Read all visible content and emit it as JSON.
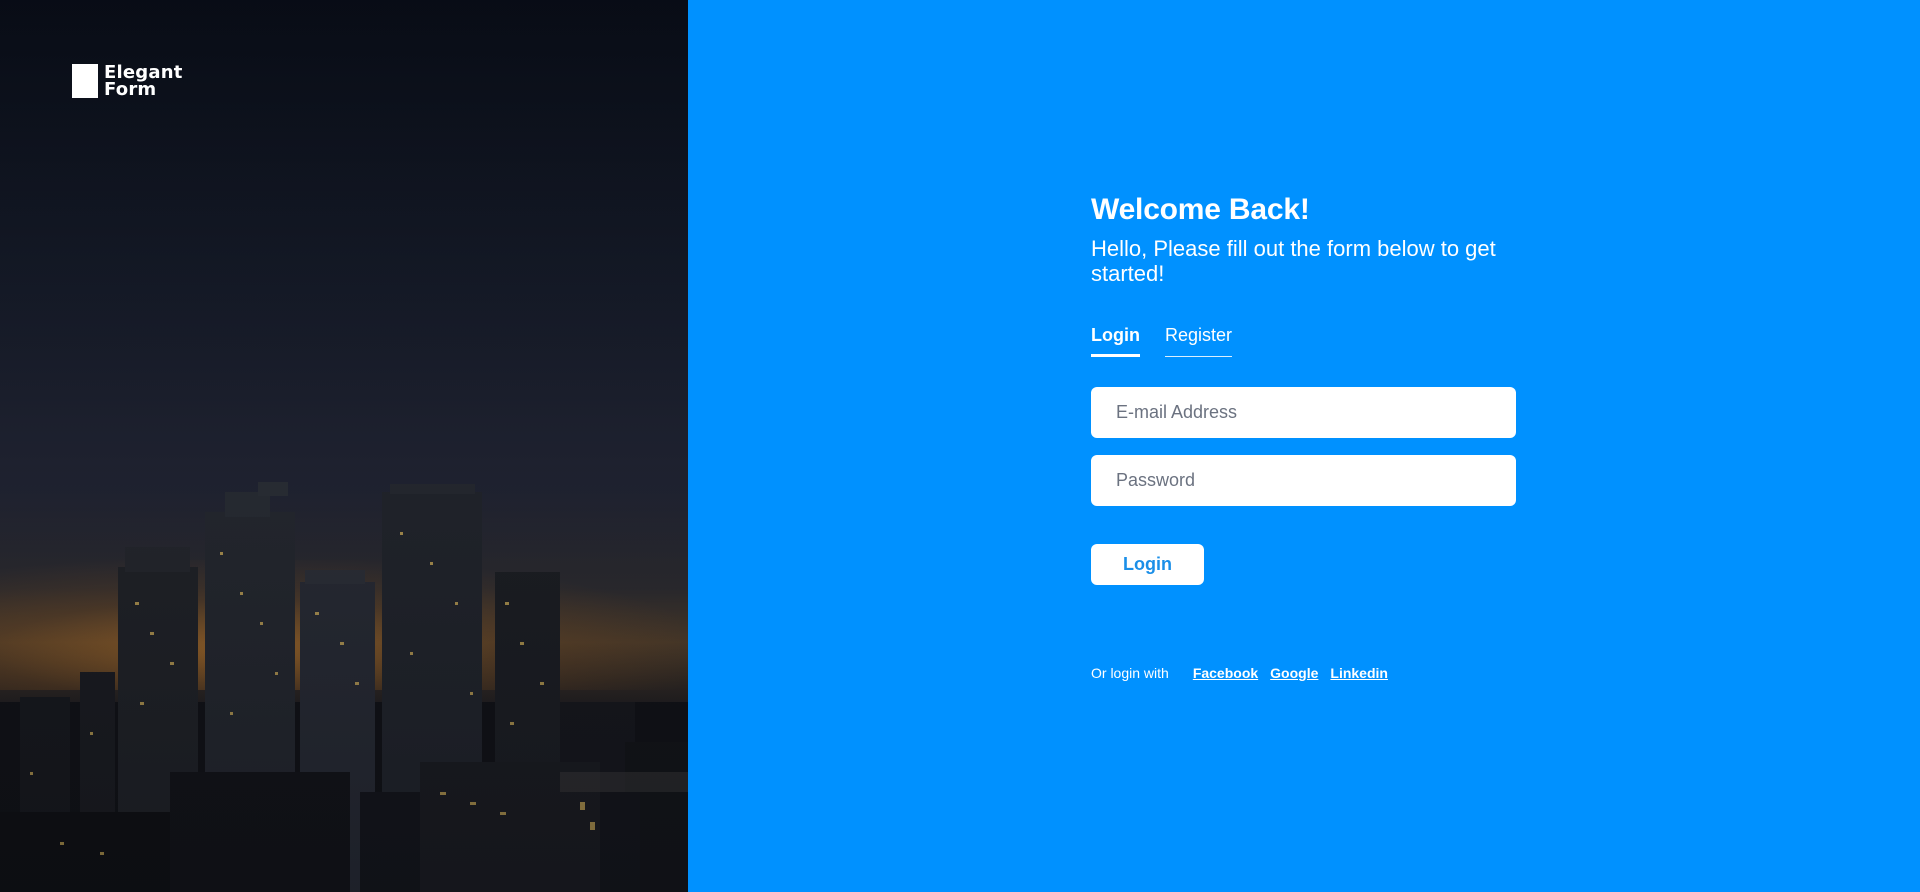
{
  "brand": {
    "line1": "Elegant",
    "line2": "Form",
    "logo_icon": "stamp-icon"
  },
  "form": {
    "title": "Welcome Back!",
    "subtitle": "Hello, Please fill out the form below to get started!",
    "tabs": [
      {
        "label": "Login",
        "active": true
      },
      {
        "label": "Register",
        "active": false
      }
    ],
    "email": {
      "placeholder": "E-mail Address",
      "value": ""
    },
    "password": {
      "placeholder": "Password",
      "value": ""
    },
    "submit_label": "Login"
  },
  "social": {
    "label": "Or login with",
    "links": [
      "Facebook",
      "Google",
      "Linkedin"
    ]
  },
  "colors": {
    "panel_blue": "#0091ff",
    "button_text": "#1b8fe8",
    "white": "#ffffff"
  }
}
